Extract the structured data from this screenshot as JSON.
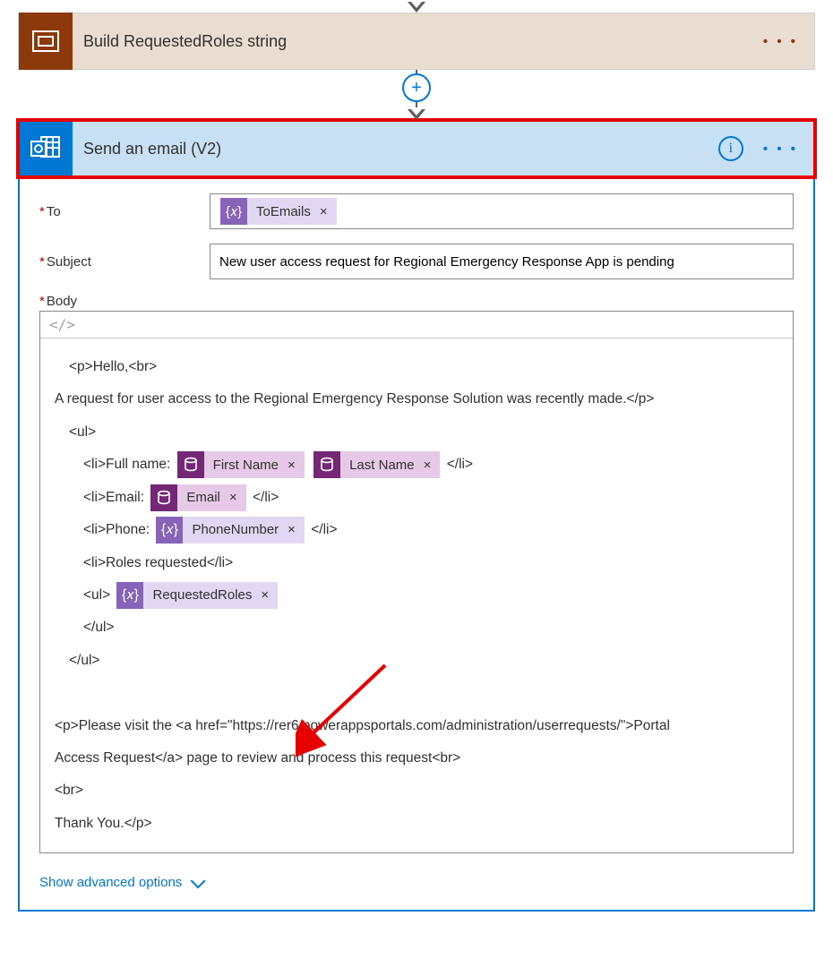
{
  "arrow": {
    "plus_glyph": "+"
  },
  "build_card": {
    "title": "Build RequestedRoles string",
    "more": "• • •"
  },
  "email_card": {
    "title": "Send an email (V2)",
    "info_glyph": "i",
    "more": "• • •"
  },
  "fields": {
    "to_label": "To",
    "subject_label": "Subject",
    "subject_value": "New user access request for Regional Emergency Response App is pending",
    "body_label": "Body"
  },
  "tokens": {
    "to_emails": "ToEmails",
    "first_name": "First Name",
    "last_name": "Last Name",
    "email": "Email",
    "phone": "PhoneNumber",
    "requested_roles": "RequestedRoles",
    "fx_glyph": "{𝑥}",
    "x_glyph": "×"
  },
  "body_lines": {
    "l1a": "<p>Hello,<br>",
    "l2": "A request for user access to the Regional Emergency Response Solution was recently made.</p>",
    "l3": "<ul>",
    "l4_pre": "<li>Full name:",
    "l4_post": "</li>",
    "l5_pre": "<li>Email:",
    "l5_post": "</li>",
    "l6_pre": "<li>Phone:",
    "l6_post": "</li>",
    "l7": "<li>Roles requested</li>",
    "l8_pre": "<ul>",
    "l9": "</ul>",
    "l10": "</ul>",
    "l12": "<p>Please visit the <a href=\"https://rer6.powerappsportals.com/administration/userrequests/\">Portal",
    "l13": "Access Request</a> page to review and process this request<br>",
    "l14": "<br>",
    "l15": "Thank You.</p>"
  },
  "toolbar": {
    "code_glyph": "</>"
  },
  "advanced": {
    "label": "Show advanced options"
  }
}
